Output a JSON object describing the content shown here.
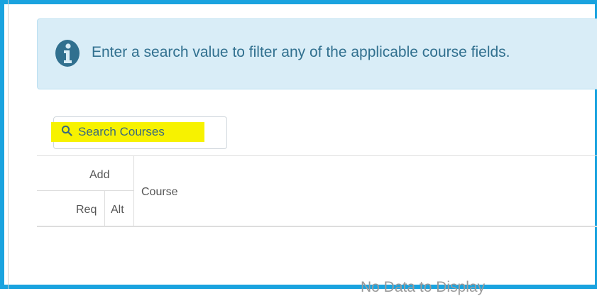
{
  "info": {
    "icon": "info-circle-icon",
    "message": "Enter a search value to filter any of the applicable course fields."
  },
  "search": {
    "icon": "search-icon",
    "placeholder": "Search Courses",
    "value": ""
  },
  "table": {
    "group_header": "Add",
    "columns": {
      "req": "Req",
      "alt": "Alt",
      "course": "Course"
    },
    "empty_message": "No Data to Display"
  },
  "colors": {
    "frame_border": "#1aa3df",
    "info_background": "#d9edf7",
    "info_text": "#31708f",
    "highlight": "#f7f200"
  }
}
